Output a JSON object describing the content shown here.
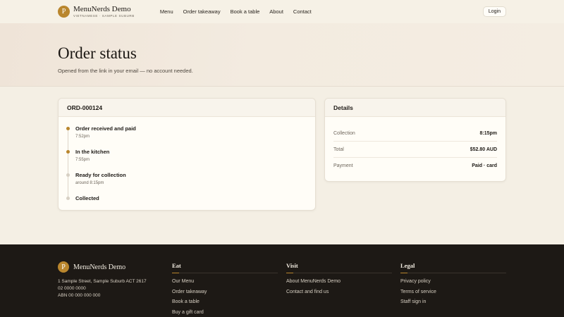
{
  "header": {
    "logo_letter": "P",
    "brand_name": "MenuNerds Demo",
    "brand_tagline": "VIETNAMESE · SAMPLE SUBURB",
    "nav": [
      "Menu",
      "Order takeaway",
      "Book a table",
      "About",
      "Contact"
    ],
    "login_label": "Login"
  },
  "hero": {
    "title": "Order status",
    "subtitle": "Opened from the link in your email — no account needed."
  },
  "order": {
    "id": "ORD-000124",
    "steps": [
      {
        "title": "Order received and paid",
        "time": "7:52pm",
        "done": true
      },
      {
        "title": "In the kitchen",
        "time": "7:55pm",
        "done": true
      },
      {
        "title": "Ready for collection",
        "time": "around 8:15pm",
        "done": false
      },
      {
        "title": "Collected",
        "time": "",
        "done": false
      }
    ]
  },
  "details": {
    "heading": "Details",
    "rows": [
      {
        "label": "Collection",
        "value": "8:15pm"
      },
      {
        "label": "Total",
        "value": "$52.80 AUD"
      },
      {
        "label": "Payment",
        "value": "Paid · card"
      }
    ]
  },
  "footer": {
    "brand_name": "MenuNerds Demo",
    "address": "1 Sample Street, Sample Suburb ACT 2617",
    "phone": "02 0000 0000",
    "abn": "ABN 00 000 000 000",
    "columns": [
      {
        "heading": "Eat",
        "links": [
          "Our Menu",
          "Order takeaway",
          "Book a table",
          "Buy a gift card"
        ]
      },
      {
        "heading": "Visit",
        "links": [
          "About MenuNerds Demo",
          "Contact and find us"
        ]
      },
      {
        "heading": "Legal",
        "links": [
          "Privacy policy",
          "Terms of service",
          "Staff sign in"
        ]
      }
    ]
  },
  "colors": {
    "accent": "#b9862d",
    "background": "#f4efe4",
    "footer_bg": "#1d1915"
  }
}
